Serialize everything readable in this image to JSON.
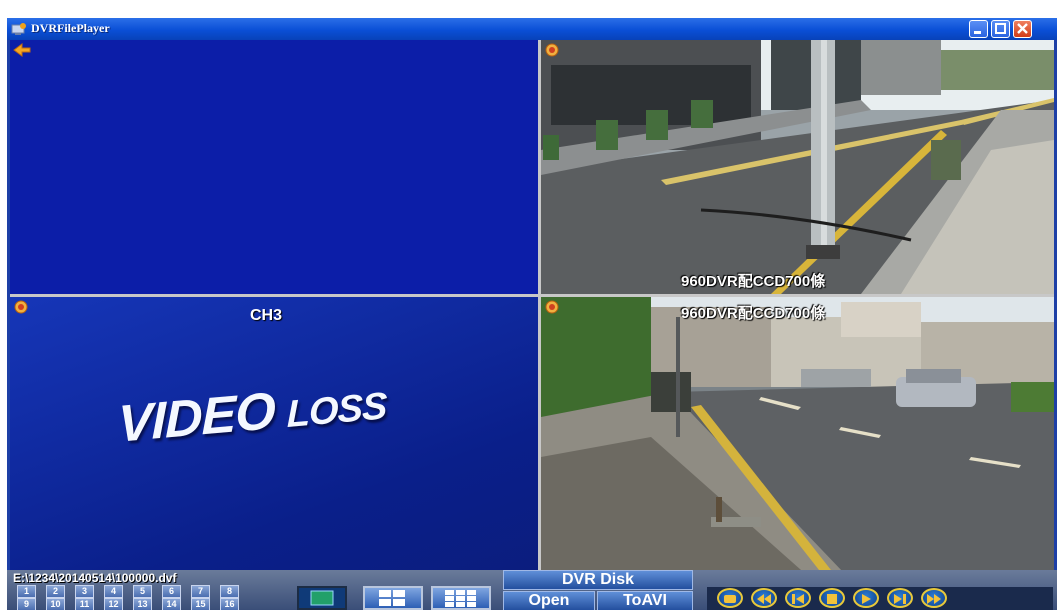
{
  "window": {
    "title": "DVRFilePlayer",
    "controls": [
      "minimize-icon",
      "maximize-icon",
      "close-icon"
    ]
  },
  "channels": [
    {
      "id": 1,
      "osd_bottom": "",
      "osd_top": "",
      "state": "blank"
    },
    {
      "id": 2,
      "osd_bottom": "960DVR配CCD700條",
      "osd_top": "",
      "state": "video"
    },
    {
      "id": 3,
      "label": "CH3",
      "video_loss_main": "VIDEO",
      "video_loss_sub": "LOSS",
      "state": "video-loss"
    },
    {
      "id": 4,
      "osd_top": "960DVR配CCD700條",
      "state": "video"
    }
  ],
  "bottom_bar": {
    "file_path": "E:\\1234\\20140514\\100000.dvf",
    "channel_buttons": [
      "1",
      "2",
      "3",
      "4",
      "5",
      "6",
      "7",
      "8",
      "9",
      "10",
      "11",
      "12",
      "13",
      "14",
      "15",
      "16"
    ],
    "layout_buttons": [
      "layout-1-icon",
      "layout-4-icon",
      "layout-9-icon"
    ],
    "dvr_disk_label": "DVR Disk",
    "open_label": "Open",
    "toavi_label": "ToAVI",
    "playback_buttons": [
      "capture-icon",
      "rewind-icon",
      "step-back-icon",
      "stop-icon",
      "play-icon",
      "step-forward-icon",
      "fast-forward-icon"
    ]
  }
}
